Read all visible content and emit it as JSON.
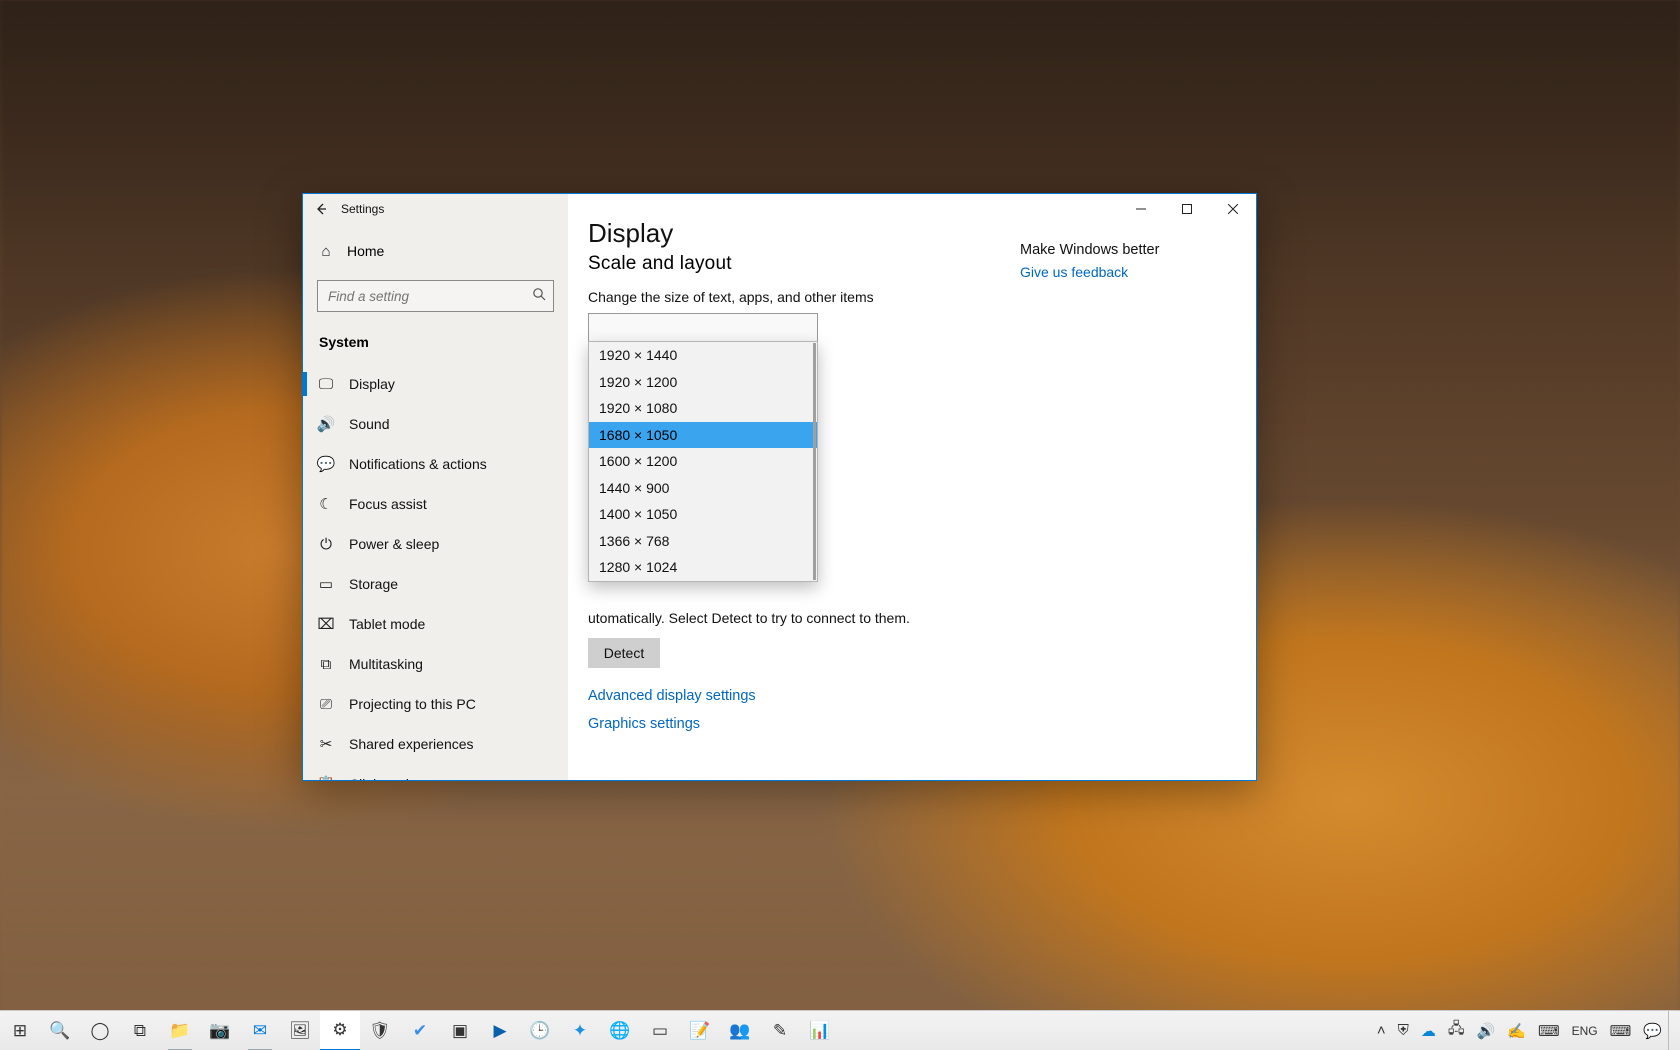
{
  "window": {
    "title": "Settings",
    "home_label": "Home",
    "search_placeholder": "Find a setting",
    "section": "System"
  },
  "sidebar": {
    "items": [
      {
        "icon": "🖵",
        "label": "Display",
        "selected": true
      },
      {
        "icon": "🔊",
        "label": "Sound"
      },
      {
        "icon": "💬",
        "label": "Notifications & actions"
      },
      {
        "icon": "☾",
        "label": "Focus assist"
      },
      {
        "icon": "⏻",
        "label": "Power & sleep"
      },
      {
        "icon": "▭",
        "label": "Storage"
      },
      {
        "icon": "⌧",
        "label": "Tablet mode"
      },
      {
        "icon": "⧉",
        "label": "Multitasking"
      },
      {
        "icon": "⎚",
        "label": "Projecting to this PC"
      },
      {
        "icon": "✂",
        "label": "Shared experiences"
      },
      {
        "icon": "📋",
        "label": "Clipboard"
      }
    ]
  },
  "main": {
    "page_title": "Display",
    "section_title": "Scale and layout",
    "scale_label": "Change the size of text, apps, and other items",
    "resolution_options": [
      "1920 × 1440",
      "1920 × 1200",
      "1920 × 1080",
      "1680 × 1050",
      "1600 × 1200",
      "1440 × 900",
      "1400 × 1050",
      "1366 × 768",
      "1280 × 1024"
    ],
    "resolution_selected_index": 3,
    "detect_hint_suffix": "utomatically. Select Detect to try to connect to them.",
    "detect_button": "Detect",
    "adv_link": "Advanced display settings",
    "gfx_link": "Graphics settings"
  },
  "right": {
    "title": "Make Windows better",
    "link": "Give us feedback"
  },
  "taskbar": {
    "language": "ENG"
  }
}
